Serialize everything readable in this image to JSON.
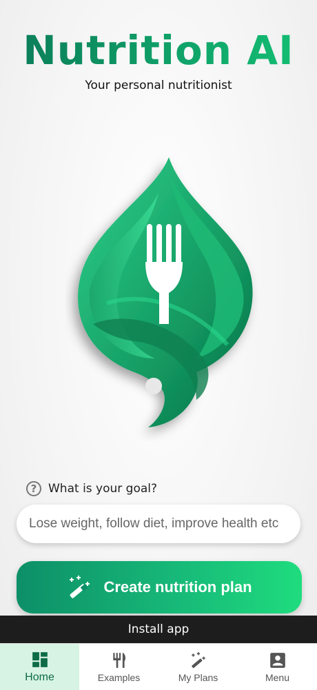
{
  "header": {
    "title": "Nutrition AI",
    "subtitle": "Your personal nutritionist"
  },
  "logo": {
    "icon": "leaf-fork-logo",
    "colors": [
      "#0d8f67",
      "#1fc07a",
      "#ffffff"
    ]
  },
  "goal": {
    "label": "What is your goal?",
    "placeholder": "Lose weight, follow diet, improve health etc"
  },
  "cta": {
    "label": "Create nutrition plan",
    "icon": "magic-wand-icon"
  },
  "install_bar": {
    "label": "Install app"
  },
  "nav": {
    "items": [
      {
        "label": "Home",
        "icon": "dashboard-icon",
        "active": true
      },
      {
        "label": "Examples",
        "icon": "cutlery-icon",
        "active": false
      },
      {
        "label": "My Plans",
        "icon": "magic-wand-icon",
        "active": false
      },
      {
        "label": "Menu",
        "icon": "account-box-icon",
        "active": false
      }
    ]
  },
  "colors": {
    "accent": "#10a56a",
    "nav_active_bg": "#d7f3e4",
    "install_bar_bg": "#1d1d1d"
  }
}
